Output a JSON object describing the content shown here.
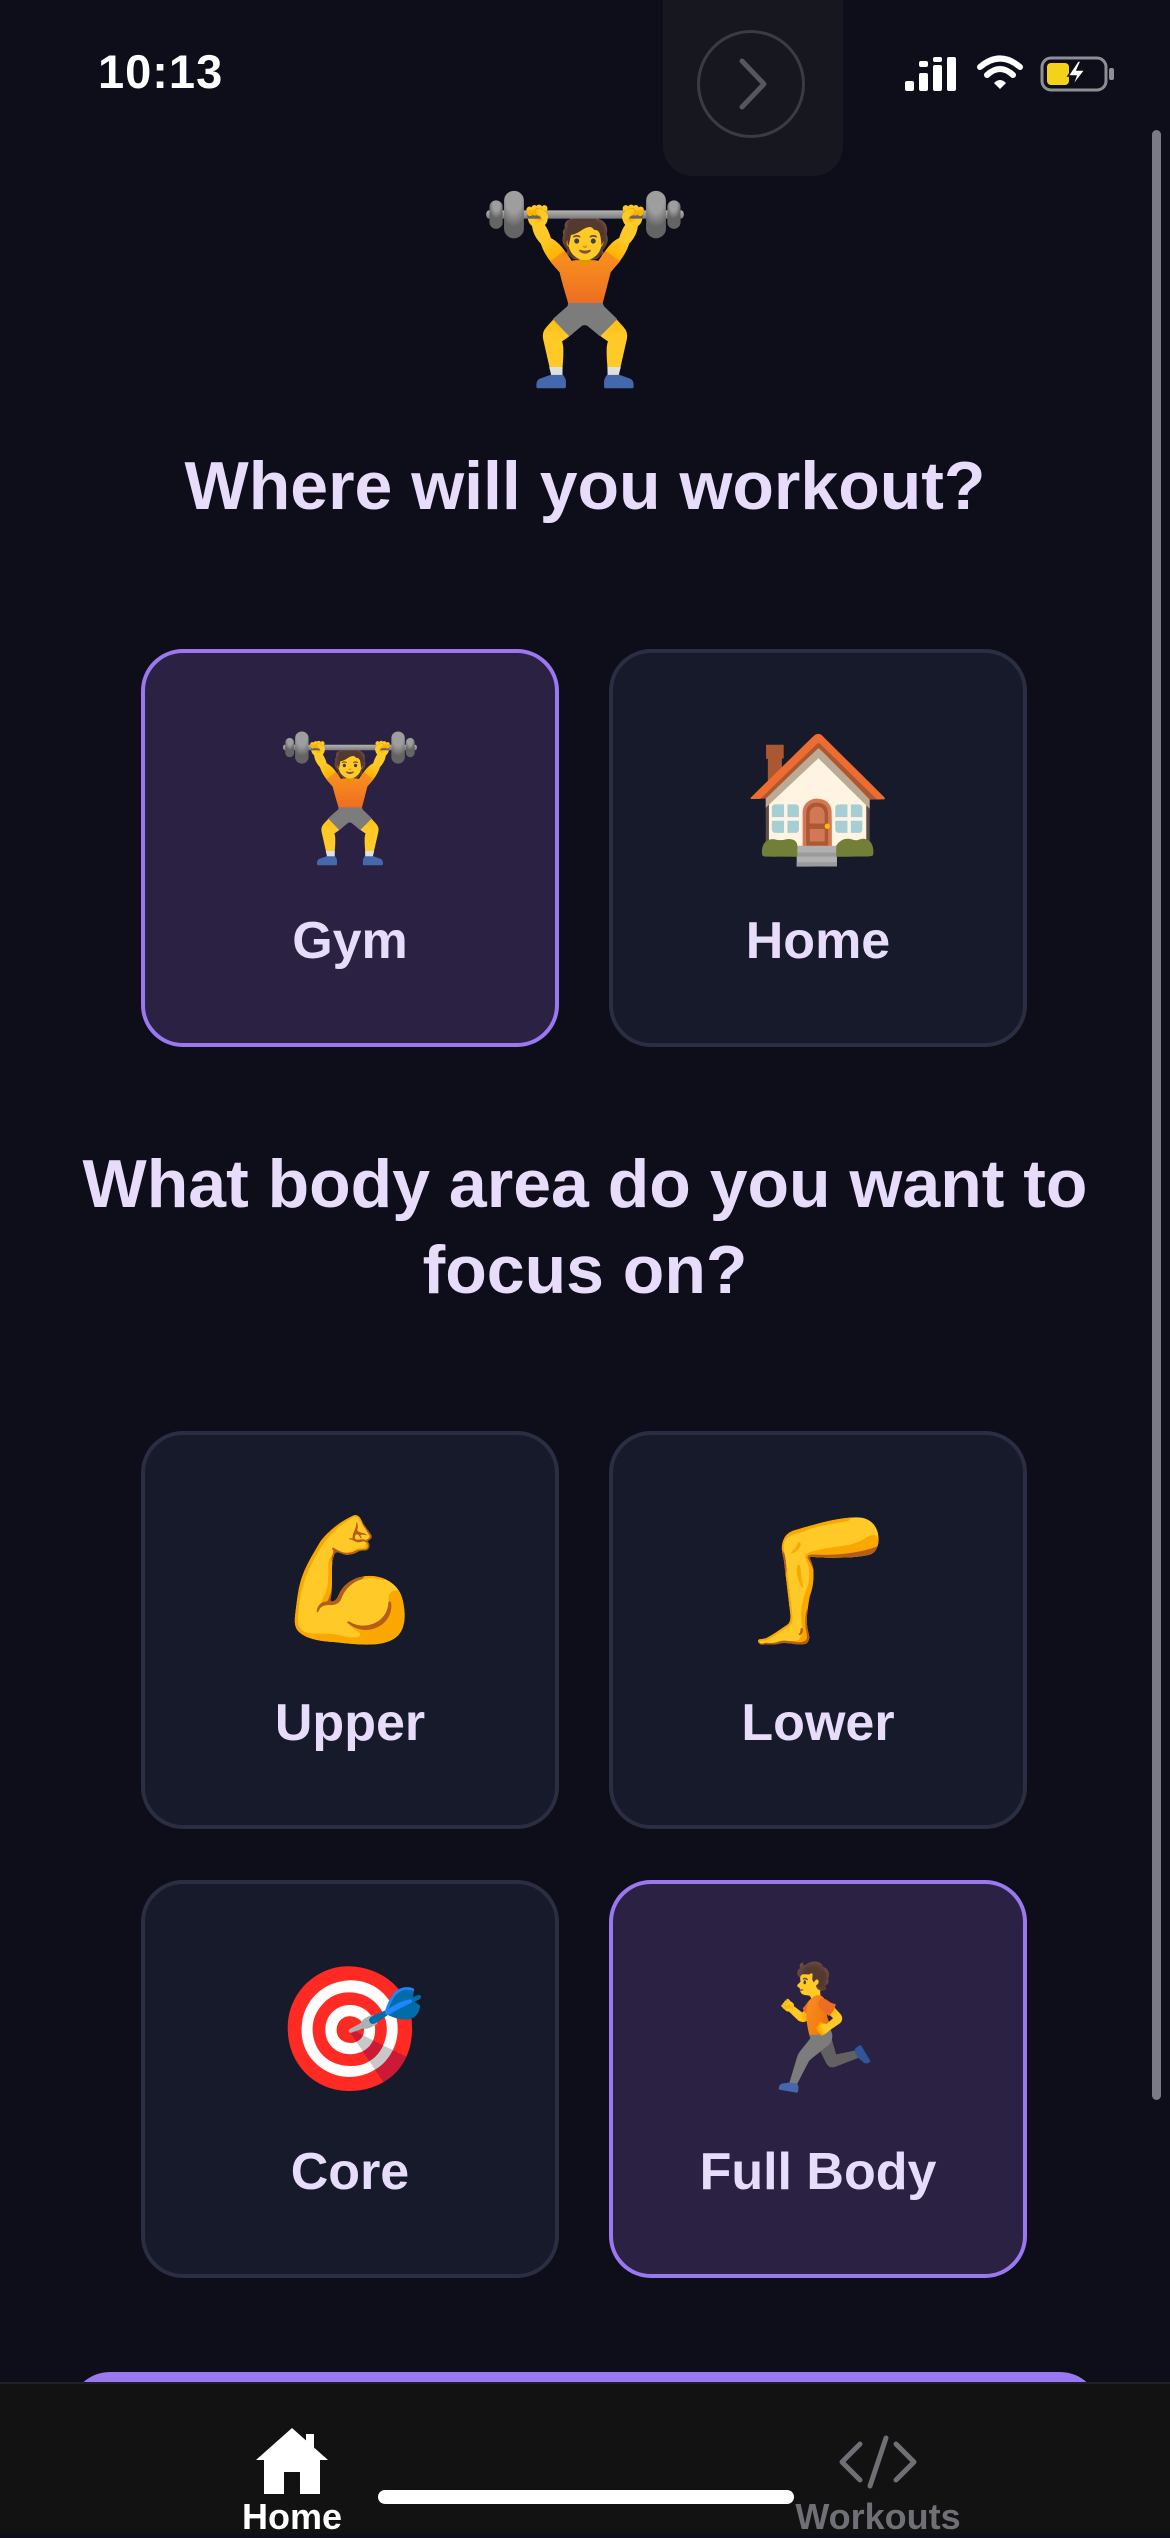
{
  "status_bar": {
    "time": "10:13"
  },
  "hero": {
    "emoji": "🏋️"
  },
  "location_section": {
    "title": "Where will you workout?",
    "options": [
      {
        "emoji": "🏋️",
        "label": "Gym",
        "selected": true
      },
      {
        "emoji": "🏠",
        "label": "Home",
        "selected": false
      }
    ]
  },
  "focus_section": {
    "title": "What body area do you want to focus on?",
    "options": [
      {
        "emoji": "💪",
        "label": "Upper",
        "selected": false
      },
      {
        "emoji": "🦵",
        "label": "Lower",
        "selected": false
      },
      {
        "emoji": "🎯",
        "label": "Core",
        "selected": false
      },
      {
        "emoji": "🏃",
        "label": "Full Body",
        "selected": true
      }
    ]
  },
  "tab_bar": {
    "tabs": [
      {
        "label": "Home",
        "icon": "home-icon",
        "active": true
      },
      {
        "label": "Workouts",
        "icon": "code-icon",
        "active": false
      }
    ]
  },
  "colors": {
    "background": "#0d0e1a",
    "card": "#161a2b",
    "card_selected": "#2b2142",
    "accent": "#9a78f0",
    "text": "#e8dcfb"
  }
}
